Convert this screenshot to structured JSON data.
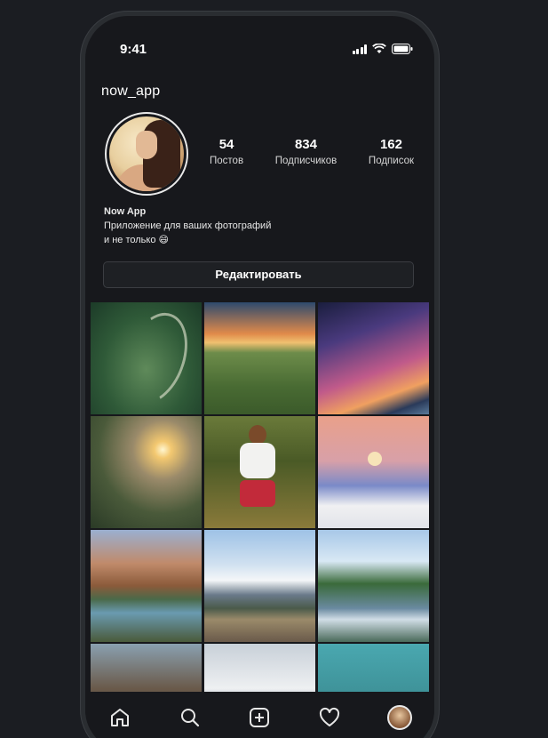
{
  "status_bar": {
    "time": "9:41"
  },
  "profile": {
    "username": "now_app",
    "stats": [
      {
        "value": "54",
        "label": "Постов"
      },
      {
        "value": "834",
        "label": "Подписчиков"
      },
      {
        "value": "162",
        "label": "Подписок"
      }
    ],
    "bio_name": "Now App",
    "bio_line1": "Приложение для ваших фотографий",
    "bio_line2": "и не только 😄",
    "edit_button": "Редактировать"
  },
  "grid": [
    "winding-road-aerial",
    "sunset-green-hills",
    "milky-way-lake",
    "sunrise-mountains",
    "woman-in-forest",
    "moon-snow-field",
    "mountain-lake-cliffs",
    "snowy-mountain-road",
    "river-mountain-valley",
    "rock-cliff",
    "snow-landscape",
    "turquoise-tree"
  ],
  "tabbar": {
    "items": [
      "home-icon",
      "search-icon",
      "add-post-icon",
      "heart-icon",
      "profile-avatar"
    ]
  }
}
